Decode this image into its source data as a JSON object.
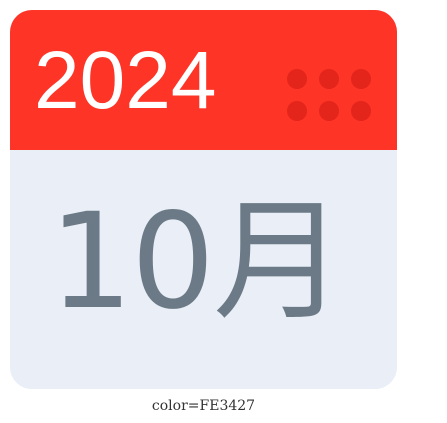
{
  "calendar": {
    "year": "2024",
    "month": "10月",
    "icon": "dots-grid-icon"
  },
  "caption": {
    "text": "color=FE3427"
  },
  "colors": {
    "header": "#FE3427",
    "header_dots": "#E4251B",
    "body": "#E9EEF7",
    "month_text": "#6B7A86",
    "year_text": "#FFFFFF"
  }
}
